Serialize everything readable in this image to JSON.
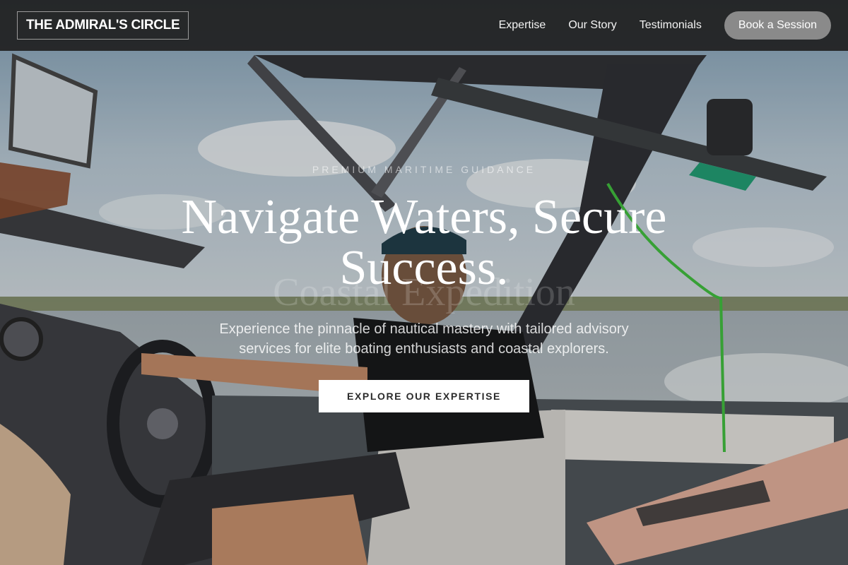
{
  "brand": {
    "logo_text": "THE ADMIRAL'S CIRCLE"
  },
  "nav": {
    "links": [
      "Expertise",
      "Our Story",
      "Testimonials"
    ],
    "cta_label": "Book a Session"
  },
  "hero": {
    "eyebrow": "PREMIUM MARITIME GUIDANCE",
    "headline": "Navigate Waters, Secure Success.",
    "watermark": "Coastal Expedition",
    "subtext": "Experience the pinnacle of nautical mastery with tailored advisory services for elite boating enthusiasts and coastal explorers.",
    "cta_label": "EXPLORE OUR EXPERTISE"
  },
  "colors": {
    "navbar_bg": "#202020",
    "nav_cta_bg": "#8a8a8a",
    "cta_bg": "#ffffff",
    "cta_text": "#2b2b2b"
  },
  "icons": {}
}
